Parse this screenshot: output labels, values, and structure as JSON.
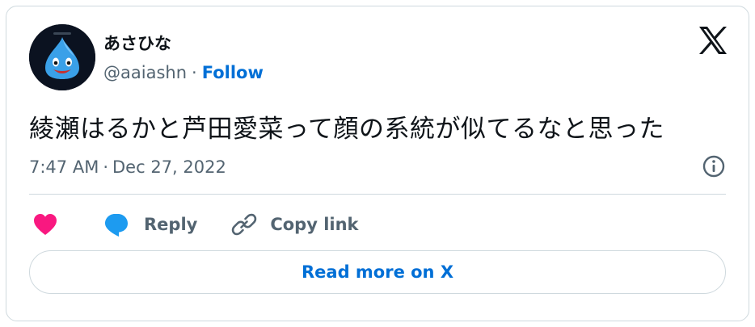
{
  "user": {
    "display_name": "あさひな",
    "handle": "@aaiashn",
    "separator": "·",
    "follow_label": "Follow",
    "avatar_icon": "slime-avatar-icon"
  },
  "tweet": {
    "text": "綾瀬はるかと芦田愛菜って顔の系統が似てるなと思った",
    "time": "7:47 AM",
    "date_separator": "·",
    "date": "Dec 27, 2022"
  },
  "actions": {
    "like_icon": "heart-icon",
    "reply_label": "Reply",
    "copy_label": "Copy link"
  },
  "read_more_label": "Read more on X",
  "colors": {
    "link_blue": "#006fd6",
    "heart_pink": "#f91880",
    "reply_blue": "#1d9bf0",
    "muted_text": "#536471",
    "text": "#0f1419",
    "border": "#cfd9de"
  }
}
